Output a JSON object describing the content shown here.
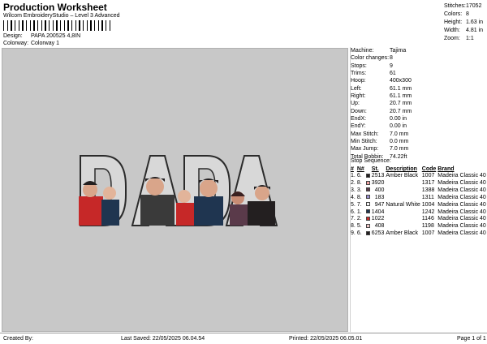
{
  "header": {
    "title": "Production Worksheet",
    "subtitle": "Wilcom EmbroideryStudio – Level 3 Advanced"
  },
  "meta": {
    "design_label": "Design:",
    "design_value": "PAPA 200525 4,8IN",
    "colorway_label": "Colorway:",
    "colorway_value": "Colorway 1"
  },
  "stats": [
    {
      "label": "Stitches:",
      "value": "17052"
    },
    {
      "label": "Colors:",
      "value": "8"
    },
    {
      "label": "Height:",
      "value": "1.63 in"
    },
    {
      "label": "Width:",
      "value": "4.81 in"
    },
    {
      "label": "Zoom:",
      "value": "1:1"
    }
  ],
  "design_preview": {
    "letters": [
      "D",
      "A",
      "D",
      "A"
    ],
    "letter_fill": "#2b2b2b"
  },
  "machine_info": [
    {
      "label": "Machine:",
      "value": "Tajima"
    },
    {
      "label": "Color changes:",
      "value": "8"
    },
    {
      "label": "Stops:",
      "value": "9"
    },
    {
      "label": "Trims:",
      "value": "61"
    },
    {
      "label": "Hoop:",
      "value": "400x300"
    },
    {
      "label": "Left:",
      "value": "61.1 mm"
    },
    {
      "label": "Right:",
      "value": "61.1 mm"
    },
    {
      "label": "Up:",
      "value": "20.7 mm"
    },
    {
      "label": "Down:",
      "value": "20.7 mm"
    },
    {
      "label": "EndX:",
      "value": "0.00 in"
    },
    {
      "label": "EndY:",
      "value": "0.00 in"
    },
    {
      "label": "Max Stitch:",
      "value": "7.0 mm"
    },
    {
      "label": "Min Stitch:",
      "value": "0.0 mm"
    },
    {
      "label": "Max Jump:",
      "value": "7.0 mm"
    },
    {
      "label": "Total Bobbin:",
      "value": "74.22ft"
    }
  ],
  "stop_sequence": {
    "heading": "Stop Sequence:",
    "columns": [
      "#",
      "N#",
      "St.",
      "Description",
      "Code",
      "Brand"
    ],
    "rows": [
      {
        "idx": "1.",
        "n": "6.",
        "color": "#231f20",
        "st": "2513",
        "desc": "Amber Black",
        "code": "1007",
        "brand": "Madeira Classic 40"
      },
      {
        "idx": "2.",
        "n": "8.",
        "color": "#f2a3a3",
        "st": "3920",
        "desc": "",
        "code": "1317",
        "brand": "Madeira Classic 40"
      },
      {
        "idx": "3.",
        "n": "3.",
        "color": "#5a3a4a",
        "st": "400",
        "desc": "",
        "code": "1388",
        "brand": "Madeira Classic 40"
      },
      {
        "idx": "4.",
        "n": "8.",
        "color": "#9a8fd0",
        "st": "183",
        "desc": "",
        "code": "1311",
        "brand": "Madeira Classic 40"
      },
      {
        "idx": "5.",
        "n": "7.",
        "color": "#f4f4f4",
        "st": "947",
        "desc": "Natural White",
        "code": "1004",
        "brand": "Madeira Classic 40"
      },
      {
        "idx": "6.",
        "n": "1.",
        "color": "#1f3550",
        "st": "1404",
        "desc": "",
        "code": "1242",
        "brand": "Madeira Classic 40"
      },
      {
        "idx": "7.",
        "n": "2.",
        "color": "#c62828",
        "st": "1022",
        "desc": "",
        "code": "1146",
        "brand": "Madeira Classic 40"
      },
      {
        "idx": "8.",
        "n": "5.",
        "color": "#f0c8c8",
        "st": "408",
        "desc": "",
        "code": "1198",
        "brand": "Madeira Classic 40"
      },
      {
        "idx": "9.",
        "n": "6.",
        "color": "#231f20",
        "st": "6253",
        "desc": "Amber Black",
        "code": "1007",
        "brand": "Madeira Classic 40"
      }
    ]
  },
  "footer": {
    "created_by": "Created By:",
    "last_saved": "Last Saved: 22/05/2025 06.04.54",
    "printed": "Printed: 22/05/2025 06.05.01",
    "page": "Page 1 of 1"
  }
}
